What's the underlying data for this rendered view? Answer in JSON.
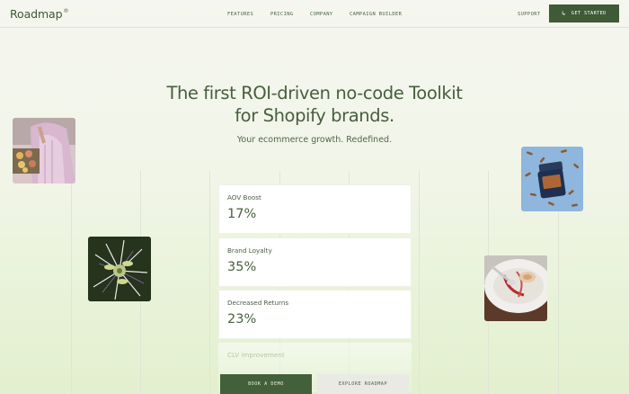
{
  "header": {
    "logo": "Roadmap",
    "logo_mark": "®",
    "nav": [
      {
        "label": "Features"
      },
      {
        "label": "Pricing"
      },
      {
        "label": "Company"
      },
      {
        "label": "Campaign Builder"
      }
    ],
    "support": "Support",
    "get_started": "Get Started"
  },
  "hero": {
    "title_line1": "The first ROI-driven no-code Toolkit",
    "title_line2": "for Shopify brands.",
    "subtitle": "Your ecommerce growth. Redefined."
  },
  "stats": [
    {
      "label": "AOV Boost",
      "value": "17%"
    },
    {
      "label": "Brand Loyalty",
      "value": "35%"
    },
    {
      "label": "Decreased Returns",
      "value": "23%"
    },
    {
      "label": "CLV improvement",
      "value": ""
    }
  ],
  "cta": {
    "book_demo": "Book a Demo",
    "explore": "Explore Roadmap"
  },
  "photos": [
    {
      "icon": "woman-serving-pastries-photo"
    },
    {
      "icon": "passion-flower-photo"
    },
    {
      "icon": "supplement-bottle-photo"
    },
    {
      "icon": "plate-dessert-photo"
    }
  ],
  "colors": {
    "brand": "#3f5a36",
    "text": "#475e3f",
    "background": "#f3f6ec"
  }
}
